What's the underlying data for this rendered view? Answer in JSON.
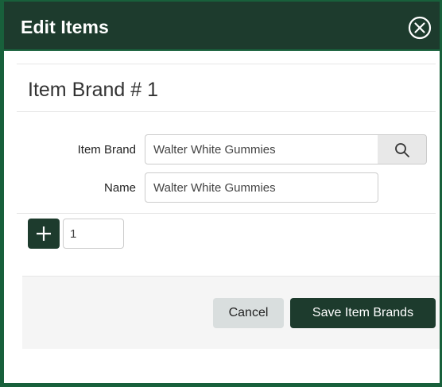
{
  "dialog": {
    "title": "Edit Items"
  },
  "section": {
    "title": "Item Brand # 1"
  },
  "form": {
    "item_brand_label": "Item Brand",
    "item_brand_value": "Walter White Gummies",
    "name_label": "Name",
    "name_value": "Walter White Gummies"
  },
  "quantity": {
    "value": "1"
  },
  "footer": {
    "cancel_label": "Cancel",
    "save_label": "Save Item Brands"
  },
  "colors": {
    "header_bg": "#1d3b2d",
    "border_accent": "#18603b",
    "primary_button": "#1d3b2d",
    "secondary_button": "#d9dede"
  },
  "icons": {
    "close": "close-circle-icon",
    "search": "search-icon",
    "add": "plus-icon"
  }
}
